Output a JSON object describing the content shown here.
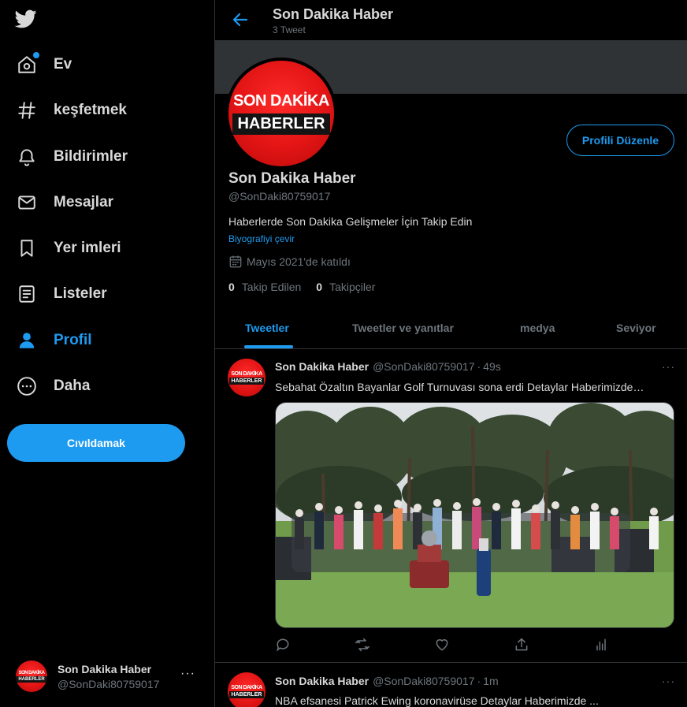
{
  "brand": {
    "accent": "#1d9bf0",
    "logo_color": "#d9d9d9"
  },
  "nav": {
    "items": [
      {
        "key": "home",
        "label": "Ev",
        "icon": "home-icon"
      },
      {
        "key": "explore",
        "label": "keşfetmek",
        "icon": "hashtag-icon"
      },
      {
        "key": "notifications",
        "label": "Bildirimler",
        "icon": "bell-icon"
      },
      {
        "key": "messages",
        "label": "Mesajlar",
        "icon": "mail-icon"
      },
      {
        "key": "bookmarks",
        "label": "Yer imleri",
        "icon": "bookmark-icon"
      },
      {
        "key": "lists",
        "label": "Listeler",
        "icon": "list-icon"
      },
      {
        "key": "profile",
        "label": "Profil",
        "icon": "user-icon"
      },
      {
        "key": "more",
        "label": "Daha",
        "icon": "more-circle-icon"
      }
    ],
    "tweet_button": "Cıvıldamak"
  },
  "account": {
    "name": "Son Dakika Haber",
    "handle": "@SonDaki80759017",
    "more": "···"
  },
  "avatar": {
    "line1": "SON DAKİKA",
    "line2": "HABERLER"
  },
  "header": {
    "title": "Son Dakika Haber",
    "subtitle": "3 Tweet"
  },
  "profile": {
    "edit_button": "Profili Düzenle",
    "name": "Son Dakika Haber",
    "handle": "@SonDaki80759017",
    "bio": "Haberlerde Son Dakika Gelişmeler İçin Takip Edin",
    "translate": "Biyografiyi çevir",
    "joined": "Mayıs 2021'de katıldı",
    "following_count": "0",
    "following_label": "Takip Edilen",
    "followers_count": "0",
    "followers_label": "Takipçiler"
  },
  "tabs": [
    {
      "label": "Tweetler",
      "active": true
    },
    {
      "label": "Tweetler ve yanıtlar",
      "active": false
    },
    {
      "label": "medya",
      "active": false
    },
    {
      "label": "Seviyor",
      "active": false
    }
  ],
  "tweets": [
    {
      "name": "Son Dakika Haber",
      "handle": "@SonDaki80759017",
      "dot": "·",
      "time": "49s",
      "text": "Sebahat Özaltın Bayanlar Golf Turnuvası sona erdi Detaylar Haberimizde…",
      "more": "···"
    },
    {
      "name": "Son Dakika Haber",
      "handle": "@SonDaki80759017",
      "dot": "·",
      "time": "1m",
      "text": "NBA efsanesi Patrick Ewing koronavirüse Detaylar Haberimizde ...",
      "more": "···"
    }
  ]
}
